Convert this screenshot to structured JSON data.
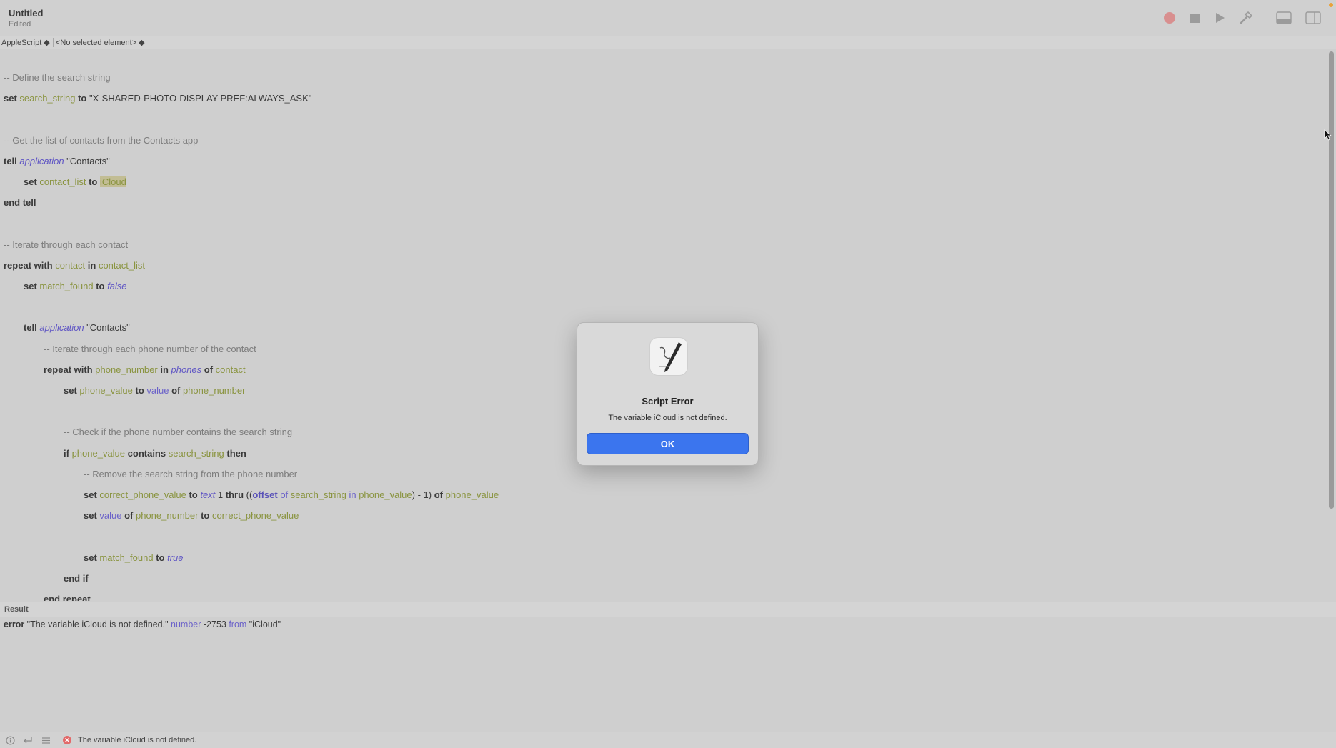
{
  "window": {
    "title": "Untitled",
    "subtitle": "Edited"
  },
  "toolbar": {
    "icons": [
      "record-icon",
      "stop-icon",
      "run-icon",
      "compile-icon",
      "show-log-icon",
      "show-inspector-icon"
    ]
  },
  "navbar": {
    "language": "AppleScript ◆",
    "element": "<No selected element> ◆"
  },
  "editor": {
    "lines": [
      {
        "indent": 0,
        "tokens": [
          {
            "t": "cm",
            "v": "-- Define the search string"
          }
        ]
      },
      {
        "indent": 0,
        "tokens": [
          {
            "t": "kw",
            "v": "set "
          },
          {
            "t": "var",
            "v": "search_string"
          },
          {
            "t": "kw",
            "v": " to "
          },
          {
            "t": "str",
            "v": "\"X-SHARED-PHOTO-DISPLAY-PREF:ALWAYS_ASK\""
          }
        ]
      },
      {
        "indent": 0,
        "tokens": []
      },
      {
        "indent": 0,
        "tokens": [
          {
            "t": "cm",
            "v": "-- Get the list of contacts from the Contacts app"
          }
        ]
      },
      {
        "indent": 0,
        "tokens": [
          {
            "t": "kw",
            "v": "tell "
          },
          {
            "t": "cls",
            "v": "application"
          },
          {
            "t": "str",
            "v": " \"Contacts\""
          }
        ]
      },
      {
        "indent": 1,
        "tokens": [
          {
            "t": "kw",
            "v": "set "
          },
          {
            "t": "var",
            "v": "contact_list"
          },
          {
            "t": "kw",
            "v": " to "
          },
          {
            "t": "hl",
            "v": "iCloud"
          }
        ]
      },
      {
        "indent": 0,
        "tokens": [
          {
            "t": "kw",
            "v": "end tell"
          }
        ]
      },
      {
        "indent": 0,
        "tokens": []
      },
      {
        "indent": 0,
        "tokens": [
          {
            "t": "cm",
            "v": "-- Iterate through each contact"
          }
        ]
      },
      {
        "indent": 0,
        "tokens": [
          {
            "t": "kw",
            "v": "repeat with "
          },
          {
            "t": "var",
            "v": "contact"
          },
          {
            "t": "kw",
            "v": " in "
          },
          {
            "t": "var",
            "v": "contact_list"
          }
        ]
      },
      {
        "indent": 1,
        "tokens": [
          {
            "t": "kw",
            "v": "set "
          },
          {
            "t": "var",
            "v": "match_found"
          },
          {
            "t": "kw",
            "v": " to "
          },
          {
            "t": "cls",
            "v": "false"
          }
        ]
      },
      {
        "indent": 0,
        "tokens": []
      },
      {
        "indent": 1,
        "tokens": [
          {
            "t": "kw",
            "v": "tell "
          },
          {
            "t": "cls",
            "v": "application"
          },
          {
            "t": "str",
            "v": " \"Contacts\""
          }
        ]
      },
      {
        "indent": 2,
        "tokens": [
          {
            "t": "cm",
            "v": "-- Iterate through each phone number of the contact"
          }
        ]
      },
      {
        "indent": 2,
        "tokens": [
          {
            "t": "kw",
            "v": "repeat with "
          },
          {
            "t": "var",
            "v": "phone_number"
          },
          {
            "t": "kw",
            "v": " in "
          },
          {
            "t": "cls",
            "v": "phones"
          },
          {
            "t": "kw",
            "v": " of "
          },
          {
            "t": "var",
            "v": "contact"
          }
        ]
      },
      {
        "indent": 3,
        "tokens": [
          {
            "t": "kw",
            "v": "set "
          },
          {
            "t": "var",
            "v": "phone_value"
          },
          {
            "t": "kw",
            "v": " to "
          },
          {
            "t": "prop",
            "v": "value"
          },
          {
            "t": "kw",
            "v": " of "
          },
          {
            "t": "var",
            "v": "phone_number"
          }
        ]
      },
      {
        "indent": 0,
        "tokens": []
      },
      {
        "indent": 3,
        "tokens": [
          {
            "t": "cm",
            "v": "-- Check if the phone number contains the search string"
          }
        ]
      },
      {
        "indent": 3,
        "tokens": [
          {
            "t": "kw",
            "v": "if "
          },
          {
            "t": "var",
            "v": "phone_value"
          },
          {
            "t": "kw",
            "v": " contains "
          },
          {
            "t": "var",
            "v": "search_string"
          },
          {
            "t": "kw",
            "v": " then"
          }
        ]
      },
      {
        "indent": 4,
        "tokens": [
          {
            "t": "cm",
            "v": "-- Remove the search string from the phone number"
          }
        ]
      },
      {
        "indent": 4,
        "tokens": [
          {
            "t": "kw",
            "v": "set "
          },
          {
            "t": "var",
            "v": "correct_phone_value"
          },
          {
            "t": "kw",
            "v": " to "
          },
          {
            "t": "cls",
            "v": "text"
          },
          {
            "t": "num",
            "v": " 1 "
          },
          {
            "t": "kw",
            "v": "thru"
          },
          {
            "t": "str",
            "v": " (("
          },
          {
            "t": "cmd",
            "v": "offset"
          },
          {
            "t": "prop",
            "v": " of "
          },
          {
            "t": "var",
            "v": "search_string"
          },
          {
            "t": "prop",
            "v": " in "
          },
          {
            "t": "var",
            "v": "phone_value"
          },
          {
            "t": "str",
            "v": ") - 1) "
          },
          {
            "t": "kw",
            "v": "of "
          },
          {
            "t": "var",
            "v": "phone_value"
          }
        ]
      },
      {
        "indent": 4,
        "tokens": [
          {
            "t": "kw",
            "v": "set "
          },
          {
            "t": "prop",
            "v": "value"
          },
          {
            "t": "kw",
            "v": " of "
          },
          {
            "t": "var",
            "v": "phone_number"
          },
          {
            "t": "kw",
            "v": " to "
          },
          {
            "t": "var",
            "v": "correct_phone_value"
          }
        ]
      },
      {
        "indent": 0,
        "tokens": []
      },
      {
        "indent": 4,
        "tokens": [
          {
            "t": "kw",
            "v": "set "
          },
          {
            "t": "var",
            "v": "match_found"
          },
          {
            "t": "kw",
            "v": " to "
          },
          {
            "t": "cls",
            "v": "true"
          }
        ]
      },
      {
        "indent": 3,
        "tokens": [
          {
            "t": "kw",
            "v": "end if"
          }
        ]
      },
      {
        "indent": 2,
        "tokens": [
          {
            "t": "kw",
            "v": "end repeat"
          }
        ]
      }
    ]
  },
  "result": {
    "header": "Result",
    "tokens": [
      {
        "t": "kw",
        "v": "error "
      },
      {
        "t": "str",
        "v": "\"The variable iCloud is not defined.\" "
      },
      {
        "t": "prop",
        "v": "number"
      },
      {
        "t": "str",
        "v": " -2753 "
      },
      {
        "t": "prop",
        "v": "from"
      },
      {
        "t": "str",
        "v": " \"iCloud\""
      }
    ]
  },
  "status": {
    "message": "The variable iCloud is not defined."
  },
  "dialog": {
    "title": "Script Error",
    "message": "The variable iCloud is not defined.",
    "ok_label": "OK"
  },
  "colors": {
    "accent": "#3b75ee",
    "comment": "#7d7d7d",
    "variable": "#8a9440",
    "class": "#5f55c4"
  }
}
